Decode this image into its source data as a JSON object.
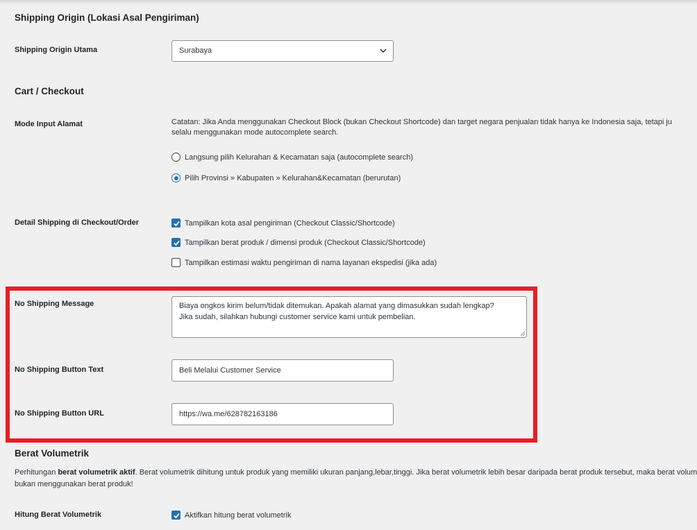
{
  "sections": {
    "shipping_origin_title": "Shipping Origin (Lokasi Asal Pengiriman)",
    "cart_checkout_title": "Cart / Checkout",
    "berat_volumetrik_title": "Berat Volumetrik"
  },
  "shipping_origin": {
    "label": "Shipping Origin Utama",
    "selected": "Surabaya"
  },
  "mode_input": {
    "label": "Mode Input Alamat",
    "note_line1": "Catatan: Jika Anda menggunakan Checkout Block (bukan Checkout Shortcode) dan target negara penjualan tidak hanya ke Indonesia saja, tetapi ju",
    "note_line2": "selalu menggunakan mode autocomplete search.",
    "options": [
      {
        "label": "Langsung pilih Kelurahan & Kecamatan saja (autocomplete search)",
        "checked": false
      },
      {
        "label": "Pilih Provinsi » Kabupaten » Kelurahan&Kecamatan (berurutan)",
        "checked": true
      }
    ]
  },
  "detail_shipping": {
    "label": "Detail Shipping di Checkout/Order",
    "options": [
      {
        "label": "Tampilkan kota asal pengiriman (Checkout Classic/Shortcode)",
        "checked": true
      },
      {
        "label": "Tampilkan berat produk / dimensi produk (Checkout Classic/Shortcode)",
        "checked": true
      },
      {
        "label": "Tampilkan estimasi waktu pengiriman di nama layanan ekspedisi (jika ada)",
        "checked": false
      }
    ]
  },
  "no_shipping": {
    "message_label": "No Shipping Message",
    "message_line1": "Biaya ongkos kirim belum/tidak ditemukan. Apakah alamat yang dimasukkan sudah lengkap?",
    "message_line2": "Jika sudah, silahkan hubungi customer service kami untuk pembelian.",
    "button_text_label": "No Shipping Button Text",
    "button_text_value": "Beli Melalui Customer Service",
    "button_url_label": "No Shipping Button URL",
    "button_url_value": "https://wa.me/628782163186"
  },
  "berat_volumetrik": {
    "para_prefix": "Perhitungan ",
    "para_bold": "berat volumetrik aktif",
    "para_line1_rest": ". Berat volumetrik dihitung untuk produk yang memiliki ukuran panjang,lebar,tinggi. Jika berat volumetrik lebih besar daripada berat produk tersebut, maka berat volumet",
    "para_line2": "bukan menggunakan berat produk!",
    "hitung_label": "Hitung Berat Volumetrik",
    "hitung_option": "Aktifkan hitung berat volumetrik",
    "hitung_checked": true
  },
  "colors": {
    "accent": "#2271b1",
    "highlight_border": "#ed1c24",
    "background": "#f0f0f1"
  }
}
